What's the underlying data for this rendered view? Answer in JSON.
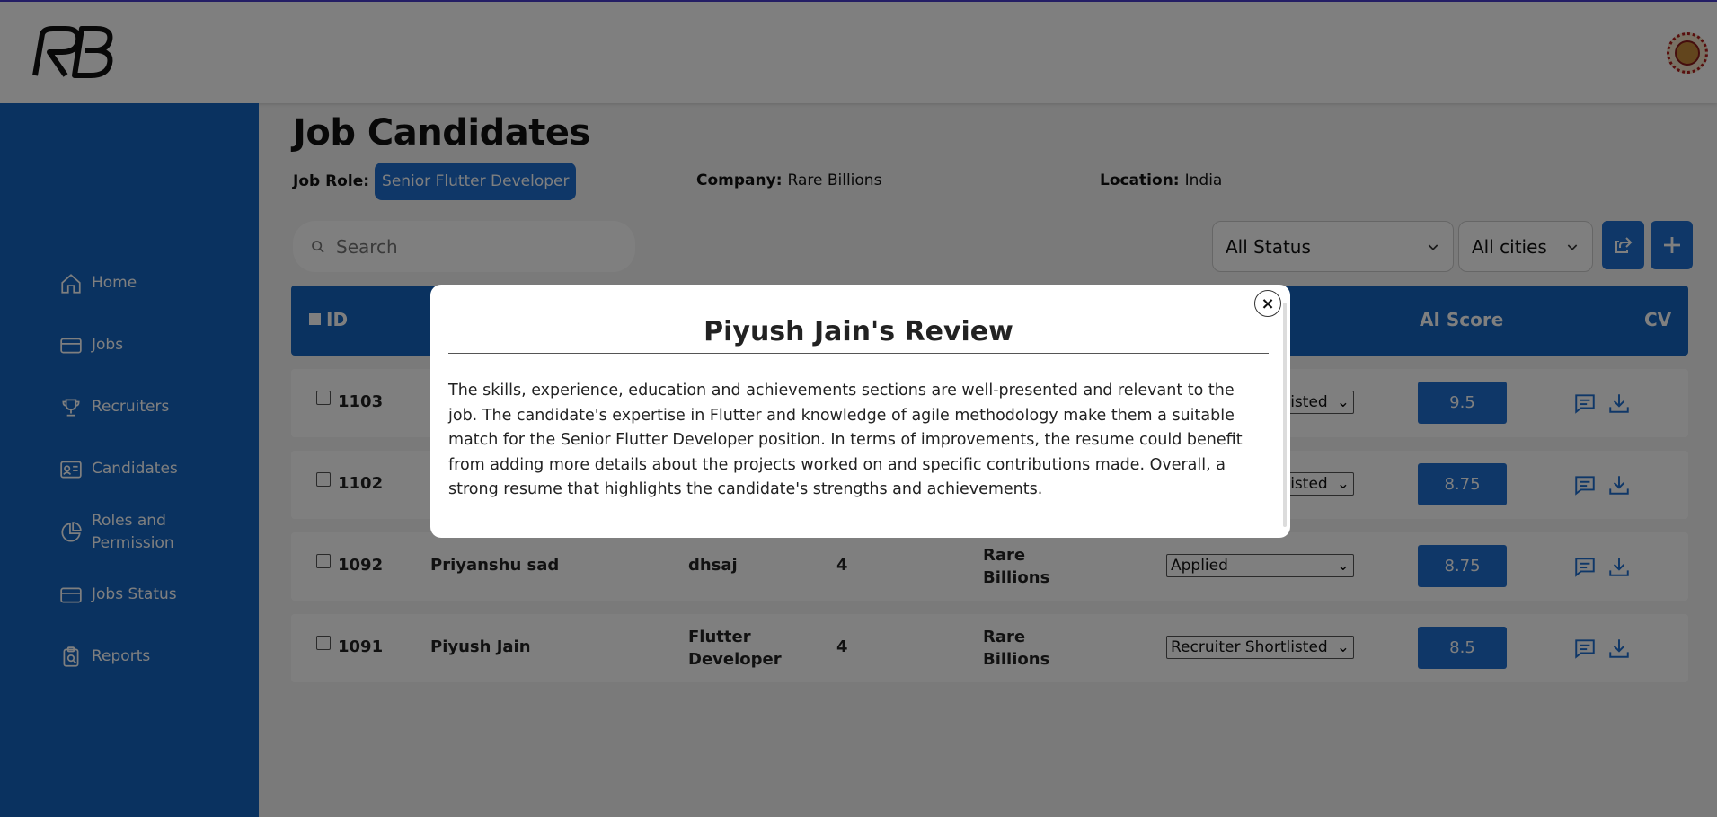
{
  "header": {
    "logo_text": "RB"
  },
  "sidebar": {
    "items": [
      {
        "label": "Home",
        "icon": "home-icon"
      },
      {
        "label": "Jobs",
        "icon": "card-icon"
      },
      {
        "label": "Recruiters",
        "icon": "trophy-icon"
      },
      {
        "label": "Candidates",
        "icon": "id-card-icon"
      },
      {
        "label": "Roles and Permission",
        "icon": "pie-chart-icon"
      },
      {
        "label": "Jobs Status",
        "icon": "card-icon"
      },
      {
        "label": "Reports",
        "icon": "report-icon"
      }
    ]
  },
  "page": {
    "title": "Job Candidates",
    "job_role_label": "Job Role:",
    "job_role_value": "Senior Flutter Developer",
    "company_label": "Company:",
    "company_value": "Rare Billions",
    "location_label": "Location:",
    "location_value": "India"
  },
  "filters": {
    "search_placeholder": "Search",
    "status_value": "All Status",
    "city_value": "All cities"
  },
  "table": {
    "headers": {
      "id": "ID",
      "ai_score": "AI Score",
      "cv": "CV"
    },
    "rows": [
      {
        "id": "1103",
        "name": "",
        "role": "",
        "exp": "",
        "company": "",
        "status": "Recruiter Shortlisted",
        "status_visible": "listed",
        "score": "9.5"
      },
      {
        "id": "1102",
        "name": "",
        "role": "",
        "exp": "",
        "company": "",
        "status": "Recruiter Shortlisted",
        "status_visible": "listed",
        "score": "8.75"
      },
      {
        "id": "1092",
        "name": "Priyanshu sad",
        "role": "dhsaj",
        "exp": "4",
        "company": "Rare Billions",
        "status": "Applied",
        "score": "8.75"
      },
      {
        "id": "1091",
        "name": "Piyush Jain",
        "role": "Flutter Developer",
        "exp": "4",
        "company": "Rare Billions",
        "status": "Recruiter Shortlisted",
        "score": "8.5"
      }
    ]
  },
  "modal": {
    "title": "Piyush Jain's Review",
    "close_label": "×",
    "body": "The skills, experience, education and achievements sections are well-presented and relevant to the job. The candidate's expertise in Flutter and knowledge of agile methodology make them a suitable match for the Senior Flutter Developer position. In terms of improvements, the resume could benefit from adding more details about the projects worked on and specific contributions made. Overall, a strong resume that highlights the candidate's strengths and achievements."
  },
  "colors": {
    "primary": "#1565c0",
    "accent": "#1e6fd0",
    "overlay": "rgba(0,0,0,0.5)"
  }
}
